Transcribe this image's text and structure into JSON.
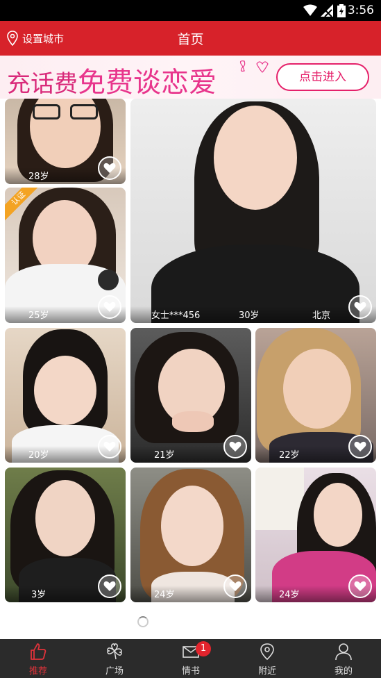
{
  "status_bar": {
    "time": "3:56"
  },
  "header": {
    "location_label": "设置城市",
    "title": "首页"
  },
  "banner": {
    "headline_1": "充话费",
    "headline_2": "免费谈恋爱",
    "button_label": "点击进入"
  },
  "cards": [
    {
      "age": "28岁"
    },
    {
      "badge": "认证",
      "age": "25岁"
    },
    {
      "name": "女士***456",
      "age": "30岁",
      "city": "北京"
    },
    {
      "age": "20岁"
    },
    {
      "age": "21岁"
    },
    {
      "age": "22岁"
    },
    {
      "age": "3岁"
    },
    {
      "age": "24岁"
    },
    {
      "age": "24岁"
    }
  ],
  "tabs": [
    {
      "label": "推荐",
      "icon": "thumbs-up-icon",
      "active": true
    },
    {
      "label": "广场",
      "icon": "clover-icon"
    },
    {
      "label": "情书",
      "icon": "envelope-icon",
      "badge": "1"
    },
    {
      "label": "附近",
      "icon": "location-pin-icon"
    },
    {
      "label": "我的",
      "icon": "user-icon"
    }
  ],
  "colors": {
    "brand_red": "#d7222a",
    "banner_pink": "#e5206a",
    "tabbar_bg": "#2b2b2b",
    "verified_orange": "#f3a323"
  }
}
